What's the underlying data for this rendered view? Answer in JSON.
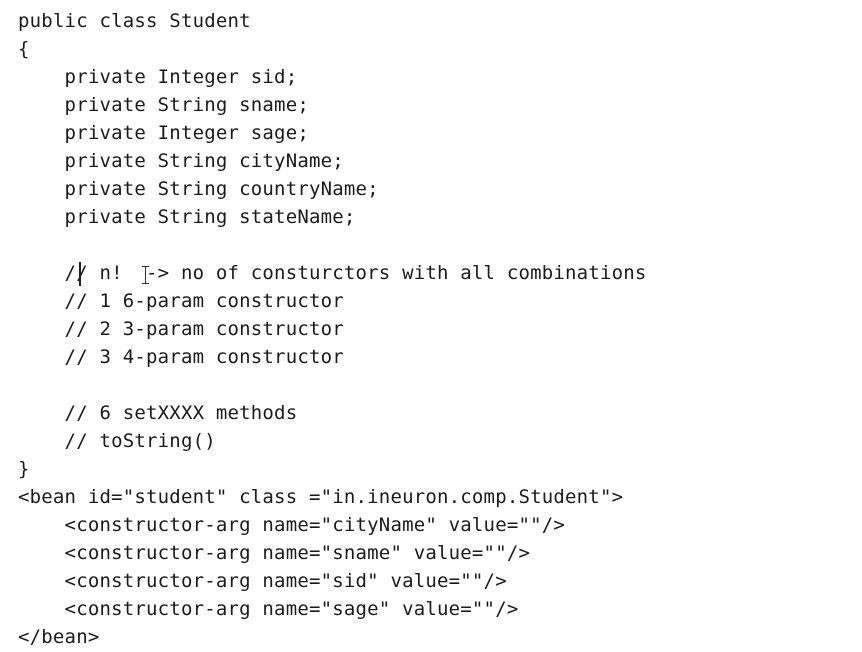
{
  "code_lines": [
    "public class Student",
    "{",
    "    private Integer sid;",
    "    private String sname;",
    "    private Integer sage;",
    "    private String cityName;",
    "    private String countryName;",
    "    private String stateName;",
    "",
    "    // n!  -> no of consturctors with all combinations",
    "    // 1 6-param constructor",
    "    // 2 3-param constructor",
    "    // 3 4-param constructor",
    "",
    "    // 6 setXXXX methods",
    "    // toString()",
    "}",
    "<bean id=\"student\" class =\"in.ineuron.comp.Student\">",
    "    <constructor-arg name=\"cityName\" value=\"\"/>",
    "    <constructor-arg name=\"sname\" value=\"\"/>",
    "    <constructor-arg name=\"sid\" value=\"\"/>",
    "    <constructor-arg name=\"sage\" value=\"\"/>",
    "</bean>"
  ]
}
